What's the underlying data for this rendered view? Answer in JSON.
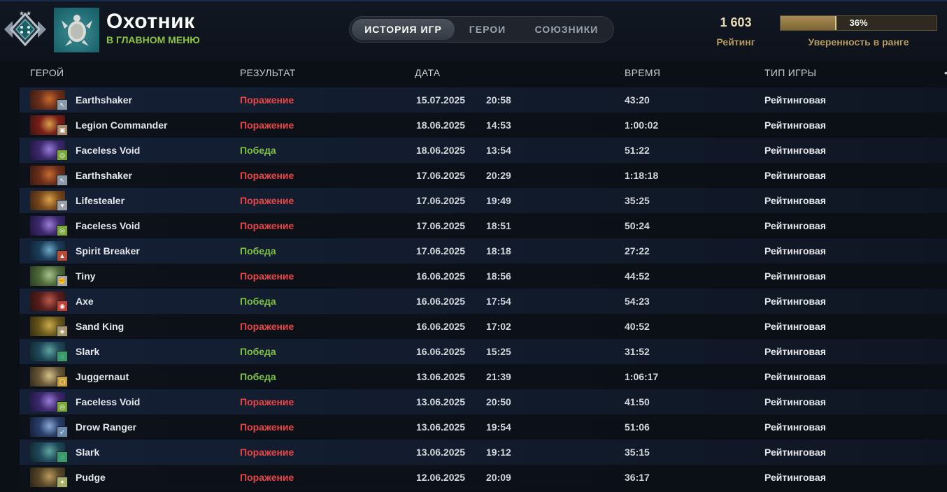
{
  "header": {
    "player_name": "Охотник",
    "player_status": "В ГЛАВНОМ МЕНЮ",
    "tabs": [
      {
        "label": "ИСТОРИЯ ИГР",
        "active": true
      },
      {
        "label": "ГЕРОИ",
        "active": false
      },
      {
        "label": "СОЮЗНИКИ",
        "active": false
      }
    ],
    "rating_value": "1 603",
    "rating_label": "Рейтинг",
    "confidence_text": "36%",
    "confidence_fraction": 0.36,
    "confidence_label": "Уверенность в ранге"
  },
  "columns": {
    "hero": "ГЕРОЙ",
    "result": "РЕЗУЛЬТАТ",
    "date": "ДАТА",
    "duration": "ВРЕМЯ",
    "type": "ТИП ИГРЫ"
  },
  "colors": {
    "win": "#7fc144",
    "loss": "#e94545",
    "accent_gold": "#b69a5e"
  },
  "matches": [
    {
      "hero": "Earthshaker",
      "result": "Поражение",
      "outcome": "loss",
      "date": "15.07.2025",
      "time": "20:58",
      "duration": "43:20",
      "type": "Рейтинговая",
      "role_icon": "initiator-icon"
    },
    {
      "hero": "Legion Commander",
      "result": "Поражение",
      "outcome": "loss",
      "date": "18.06.2025",
      "time": "14:53",
      "duration": "1:00:02",
      "type": "Рейтинговая",
      "role_icon": "shield-icon"
    },
    {
      "hero": "Faceless Void",
      "result": "Победа",
      "outcome": "win",
      "date": "18.06.2025",
      "time": "13:54",
      "duration": "51:22",
      "type": "Рейтинговая",
      "role_icon": "circle-icon"
    },
    {
      "hero": "Earthshaker",
      "result": "Поражение",
      "outcome": "loss",
      "date": "17.06.2025",
      "time": "20:29",
      "duration": "1:18:18",
      "type": "Рейтинговая",
      "role_icon": "initiator-icon"
    },
    {
      "hero": "Lifestealer",
      "result": "Поражение",
      "outcome": "loss",
      "date": "17.06.2025",
      "time": "19:49",
      "duration": "35:25",
      "type": "Рейтинговая",
      "role_icon": "heart-icon"
    },
    {
      "hero": "Faceless Void",
      "result": "Поражение",
      "outcome": "loss",
      "date": "17.06.2025",
      "time": "18:51",
      "duration": "50:24",
      "type": "Рейтинговая",
      "role_icon": "circle-icon"
    },
    {
      "hero": "Spirit Breaker",
      "result": "Победа",
      "outcome": "win",
      "date": "17.06.2025",
      "time": "18:18",
      "duration": "27:22",
      "type": "Рейтинговая",
      "role_icon": "boot-icon"
    },
    {
      "hero": "Tiny",
      "result": "Поражение",
      "outcome": "loss",
      "date": "16.06.2025",
      "time": "18:56",
      "duration": "44:52",
      "type": "Рейтинговая",
      "role_icon": "fist-icon"
    },
    {
      "hero": "Axe",
      "result": "Победа",
      "outcome": "win",
      "date": "16.06.2025",
      "time": "17:54",
      "duration": "54:23",
      "type": "Рейтинговая",
      "role_icon": "target-icon"
    },
    {
      "hero": "Sand King",
      "result": "Поражение",
      "outcome": "loss",
      "date": "16.06.2025",
      "time": "17:02",
      "duration": "40:52",
      "type": "Рейтинговая",
      "role_icon": "eye-icon"
    },
    {
      "hero": "Slark",
      "result": "Победа",
      "outcome": "win",
      "date": "16.06.2025",
      "time": "15:25",
      "duration": "31:52",
      "type": "Рейтинговая",
      "role_icon": "swirl-icon"
    },
    {
      "hero": "Juggernaut",
      "result": "Победа",
      "outcome": "win",
      "date": "13.06.2025",
      "time": "21:39",
      "duration": "1:06:17",
      "type": "Рейтинговая",
      "role_icon": "square-icon"
    },
    {
      "hero": "Faceless Void",
      "result": "Поражение",
      "outcome": "loss",
      "date": "13.06.2025",
      "time": "20:50",
      "duration": "41:50",
      "type": "Рейтинговая",
      "role_icon": "circle-icon"
    },
    {
      "hero": "Drow Ranger",
      "result": "Поражение",
      "outcome": "loss",
      "date": "13.06.2025",
      "time": "19:54",
      "duration": "51:06",
      "type": "Рейтинговая",
      "role_icon": "arrow-icon"
    },
    {
      "hero": "Slark",
      "result": "Поражение",
      "outcome": "loss",
      "date": "13.06.2025",
      "time": "19:12",
      "duration": "35:15",
      "type": "Рейтинговая",
      "role_icon": "swirl-icon"
    },
    {
      "hero": "Pudge",
      "result": "Поражение",
      "outcome": "loss",
      "date": "12.06.2025",
      "time": "20:09",
      "duration": "36:17",
      "type": "Рейтинговая",
      "role_icon": "hook-icon"
    }
  ]
}
